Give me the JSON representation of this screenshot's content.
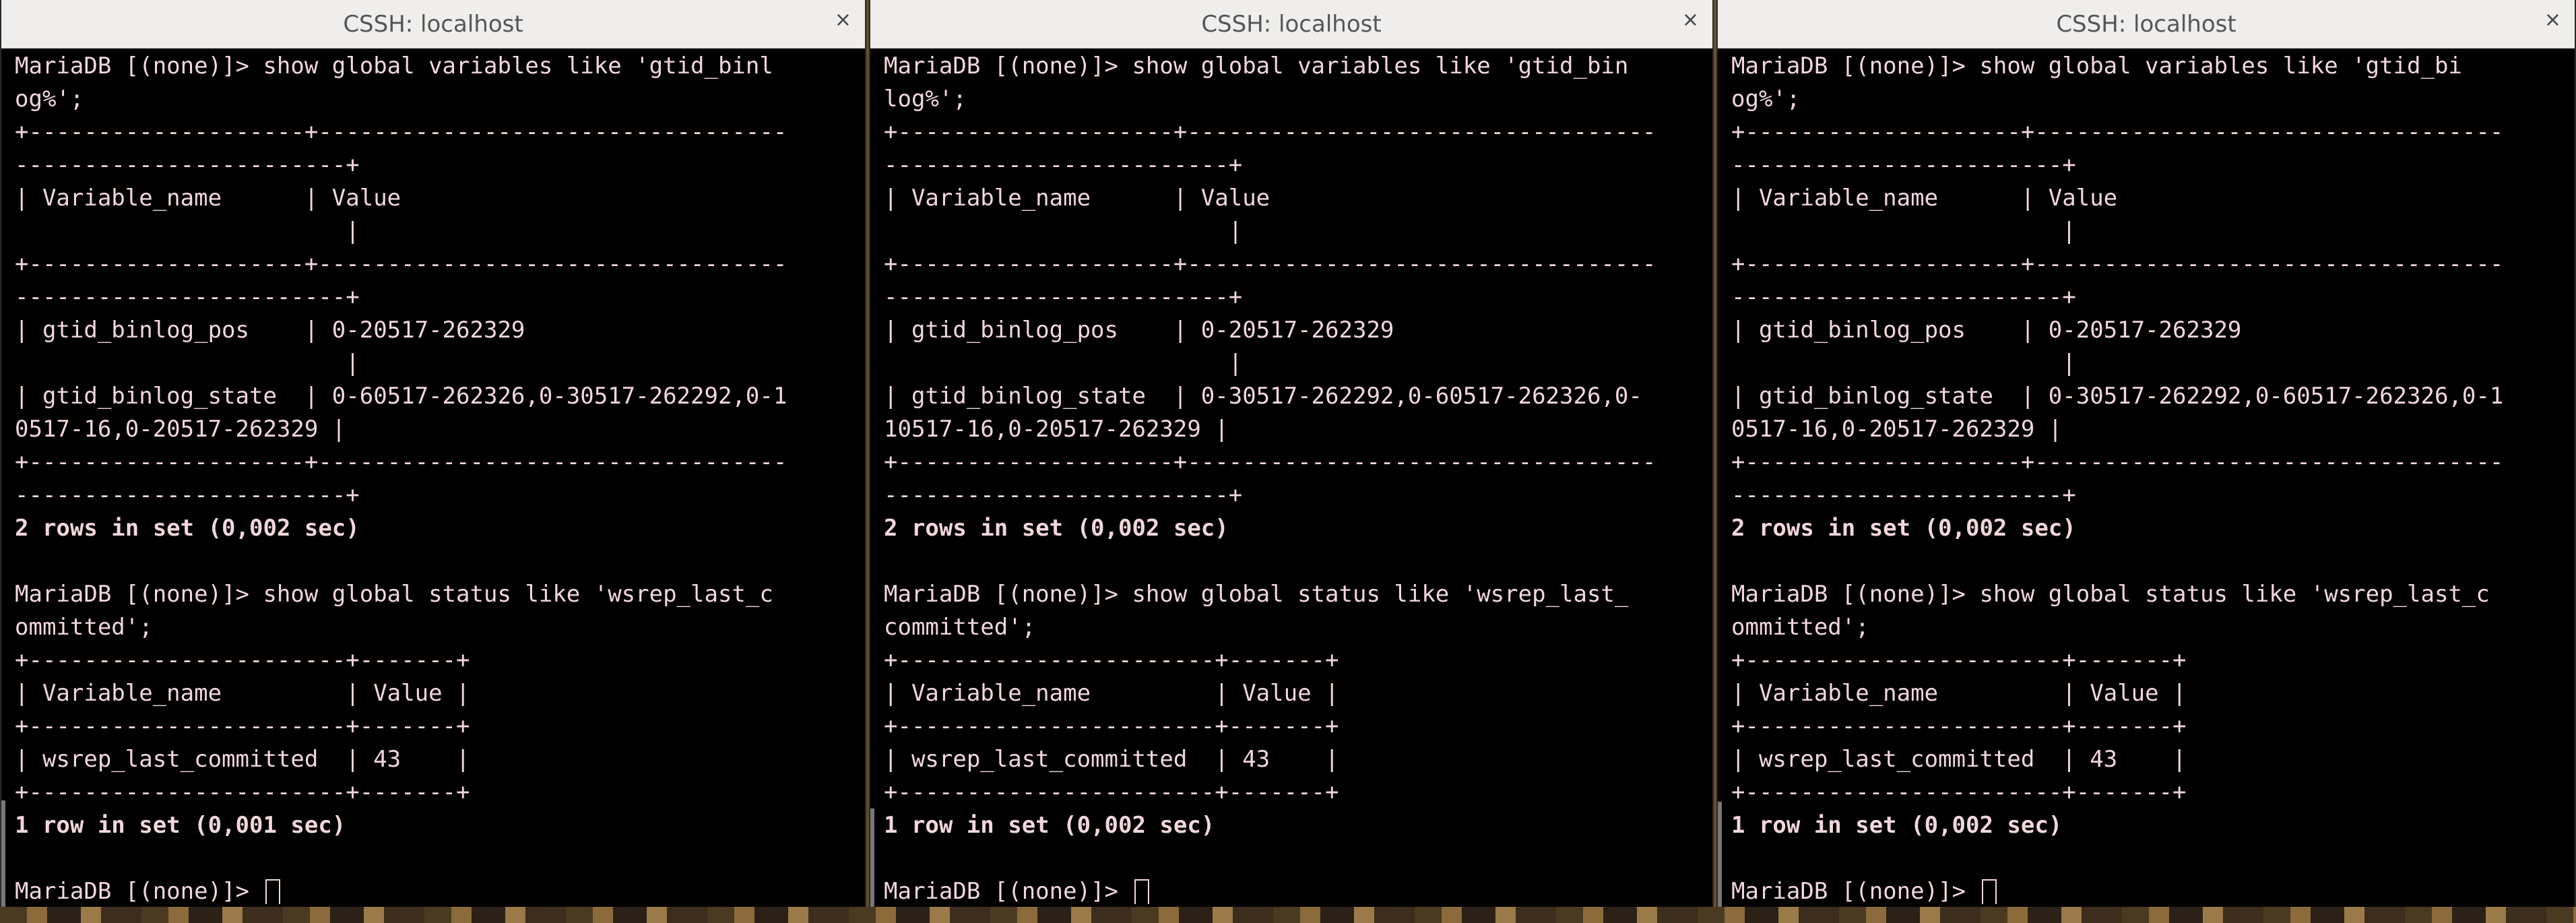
{
  "windows": [
    {
      "title": "CSSH: localhost",
      "close": "×",
      "lines": [
        "MariaDB [(none)]> show global variables like 'gtid_binl",
        "og%';",
        "+--------------------+----------------------------------",
        "------------------------+",
        "| Variable_name      | Value",
        "                        |",
        "+--------------------+----------------------------------",
        "------------------------+",
        "| gtid_binlog_pos    | 0-20517-262329",
        "                        |",
        "| gtid_binlog_state  | 0-60517-262326,0-30517-262292,0-1",
        "0517-16,0-20517-262329 |",
        "+--------------------+----------------------------------",
        "------------------------+",
        "2 rows in set (0,002 sec)",
        "",
        "MariaDB [(none)]> show global status like 'wsrep_last_c",
        "ommitted';",
        "+-----------------------+-------+",
        "| Variable_name         | Value |",
        "+-----------------------+-------+",
        "| wsrep_last_committed  | 43    |",
        "+-----------------------+-------+",
        "1 row in set (0,001 sec)",
        "",
        "MariaDB [(none)]> "
      ]
    },
    {
      "title": "CSSH: localhost",
      "close": "×",
      "lines": [
        "MariaDB [(none)]> show global variables like 'gtid_bin",
        "log%';",
        "+--------------------+----------------------------------",
        "-------------------------+",
        "| Variable_name      | Value",
        "                         |",
        "+--------------------+----------------------------------",
        "-------------------------+",
        "| gtid_binlog_pos    | 0-20517-262329",
        "                         |",
        "| gtid_binlog_state  | 0-30517-262292,0-60517-262326,0-",
        "10517-16,0-20517-262329 |",
        "+--------------------+----------------------------------",
        "-------------------------+",
        "2 rows in set (0,002 sec)",
        "",
        "MariaDB [(none)]> show global status like 'wsrep_last_",
        "committed';",
        "+-----------------------+-------+",
        "| Variable_name         | Value |",
        "+-----------------------+-------+",
        "| wsrep_last_committed  | 43    |",
        "+-----------------------+-------+",
        "1 row in set (0,002 sec)",
        "",
        "MariaDB [(none)]> "
      ]
    },
    {
      "title": "CSSH: localhost",
      "close": "×",
      "lines": [
        "MariaDB [(none)]> show global variables like 'gtid_bi",
        "og%';",
        "+--------------------+----------------------------------",
        "------------------------+",
        "| Variable_name      | Value",
        "                        |",
        "+--------------------+----------------------------------",
        "------------------------+",
        "| gtid_binlog_pos    | 0-20517-262329",
        "                        |",
        "| gtid_binlog_state  | 0-30517-262292,0-60517-262326,0-1",
        "0517-16,0-20517-262329 |",
        "+--------------------+----------------------------------",
        "------------------------+",
        "2 rows in set (0,002 sec)",
        "",
        "MariaDB [(none)]> show global status like 'wsrep_last_c",
        "ommitted';",
        "+-----------------------+-------+",
        "| Variable_name         | Value |",
        "+-----------------------+-------+",
        "| wsrep_last_committed  | 43    |",
        "+-----------------------+-------+",
        "1 row in set (0,002 sec)",
        "",
        "MariaDB [(none)]> "
      ]
    }
  ]
}
